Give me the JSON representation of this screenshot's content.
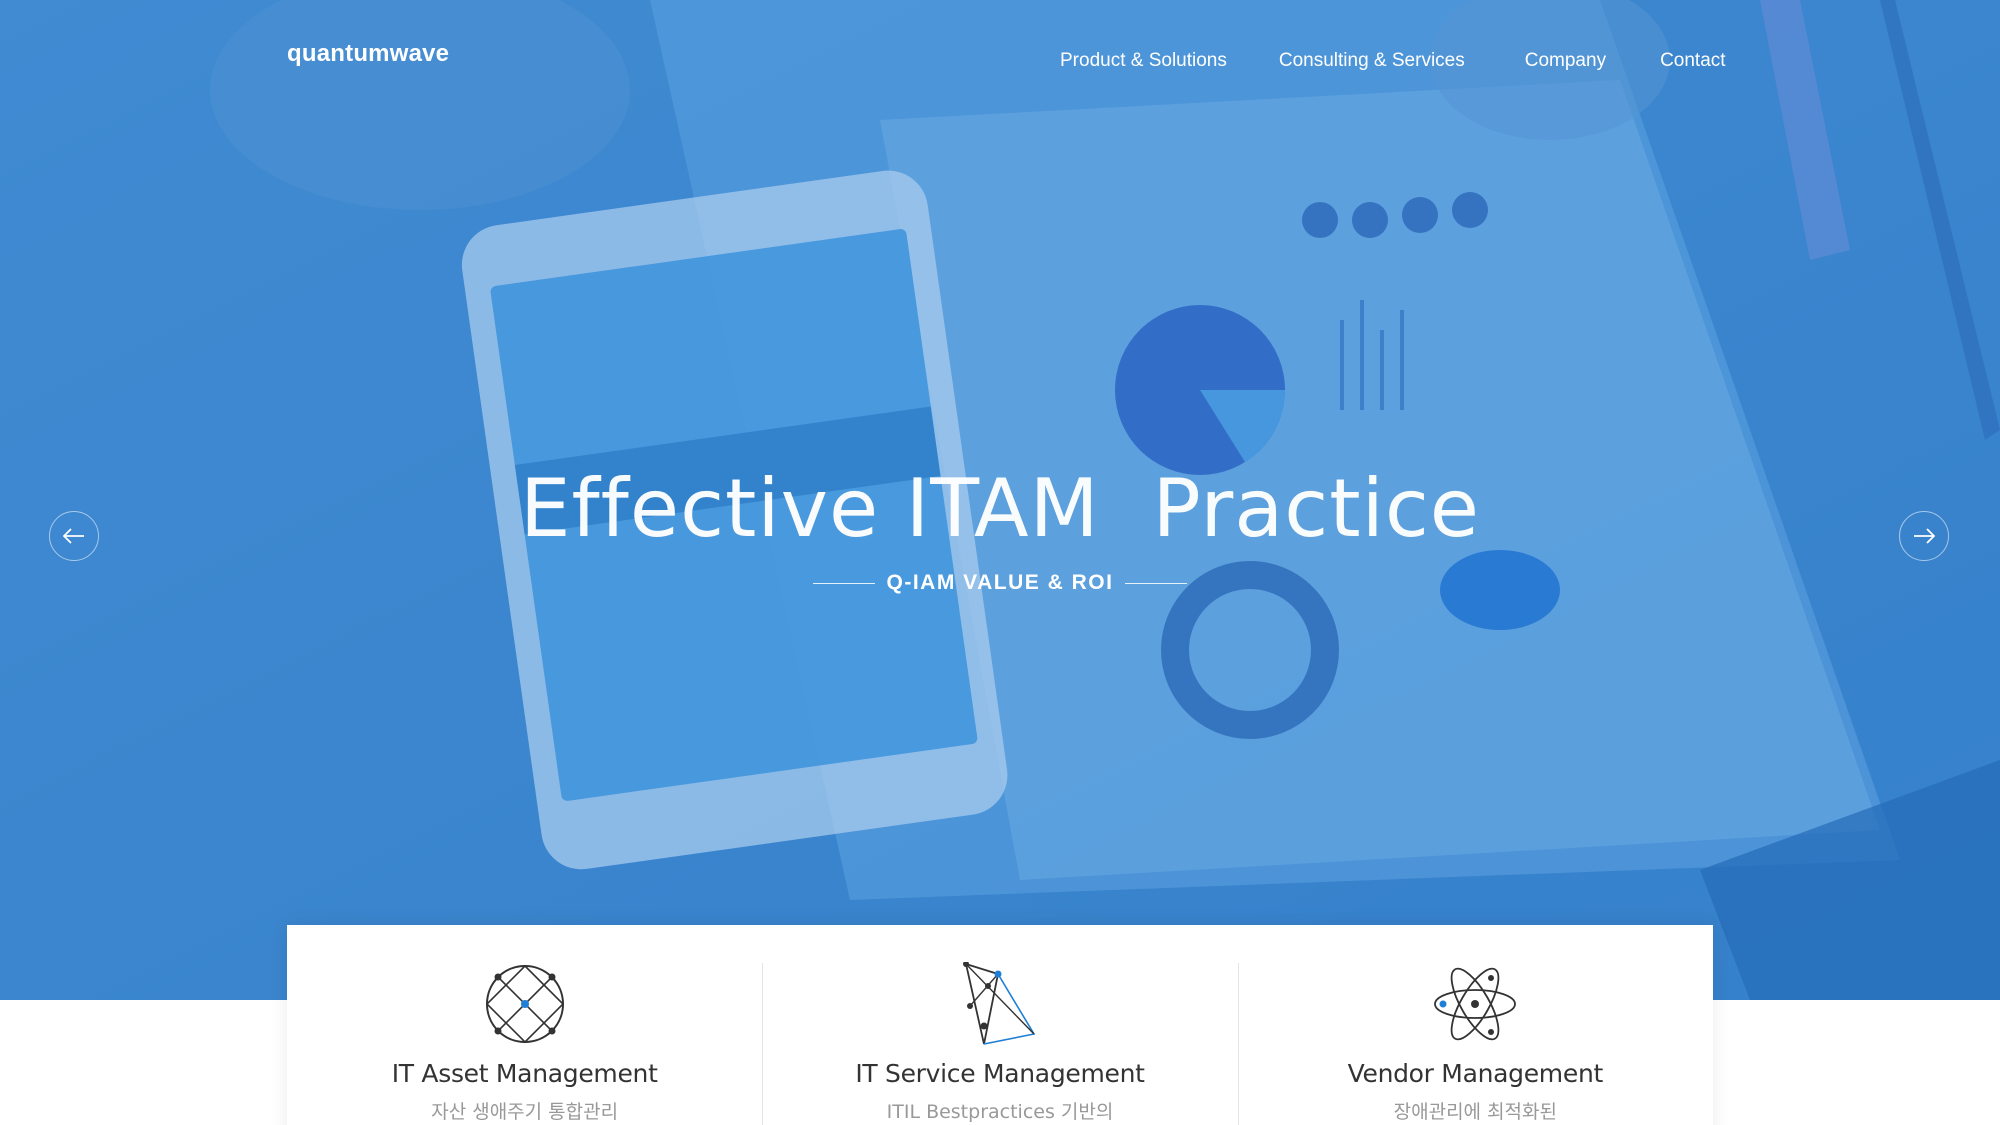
{
  "header": {
    "logo_text": "quantumwave",
    "nav": [
      {
        "label": "Product & Solutions"
      },
      {
        "label": "Consulting & Services"
      },
      {
        "label": "Company"
      },
      {
        "label": "Contact"
      }
    ]
  },
  "hero": {
    "headline": "Effective ITAM  Practice",
    "subheadline": "Q-IAM VALUE & ROI",
    "prev_icon": "arrow-left-icon",
    "next_icon": "arrow-right-icon",
    "overlay_color": "#3f8fd6"
  },
  "features": [
    {
      "title": "IT Asset Management",
      "subtitle": "자산 생애주기 통합관리",
      "icon": "network-circle-icon"
    },
    {
      "title": "IT Service Management",
      "subtitle": "ITIL Bestpractices 기반의",
      "icon": "triangle-network-icon"
    },
    {
      "title": "Vendor Management",
      "subtitle": "장애관리에 최적화된",
      "icon": "atom-orbit-icon"
    }
  ],
  "colors": {
    "accent": "#1e7fd6",
    "text_dark": "#333333",
    "text_muted": "#999999"
  }
}
